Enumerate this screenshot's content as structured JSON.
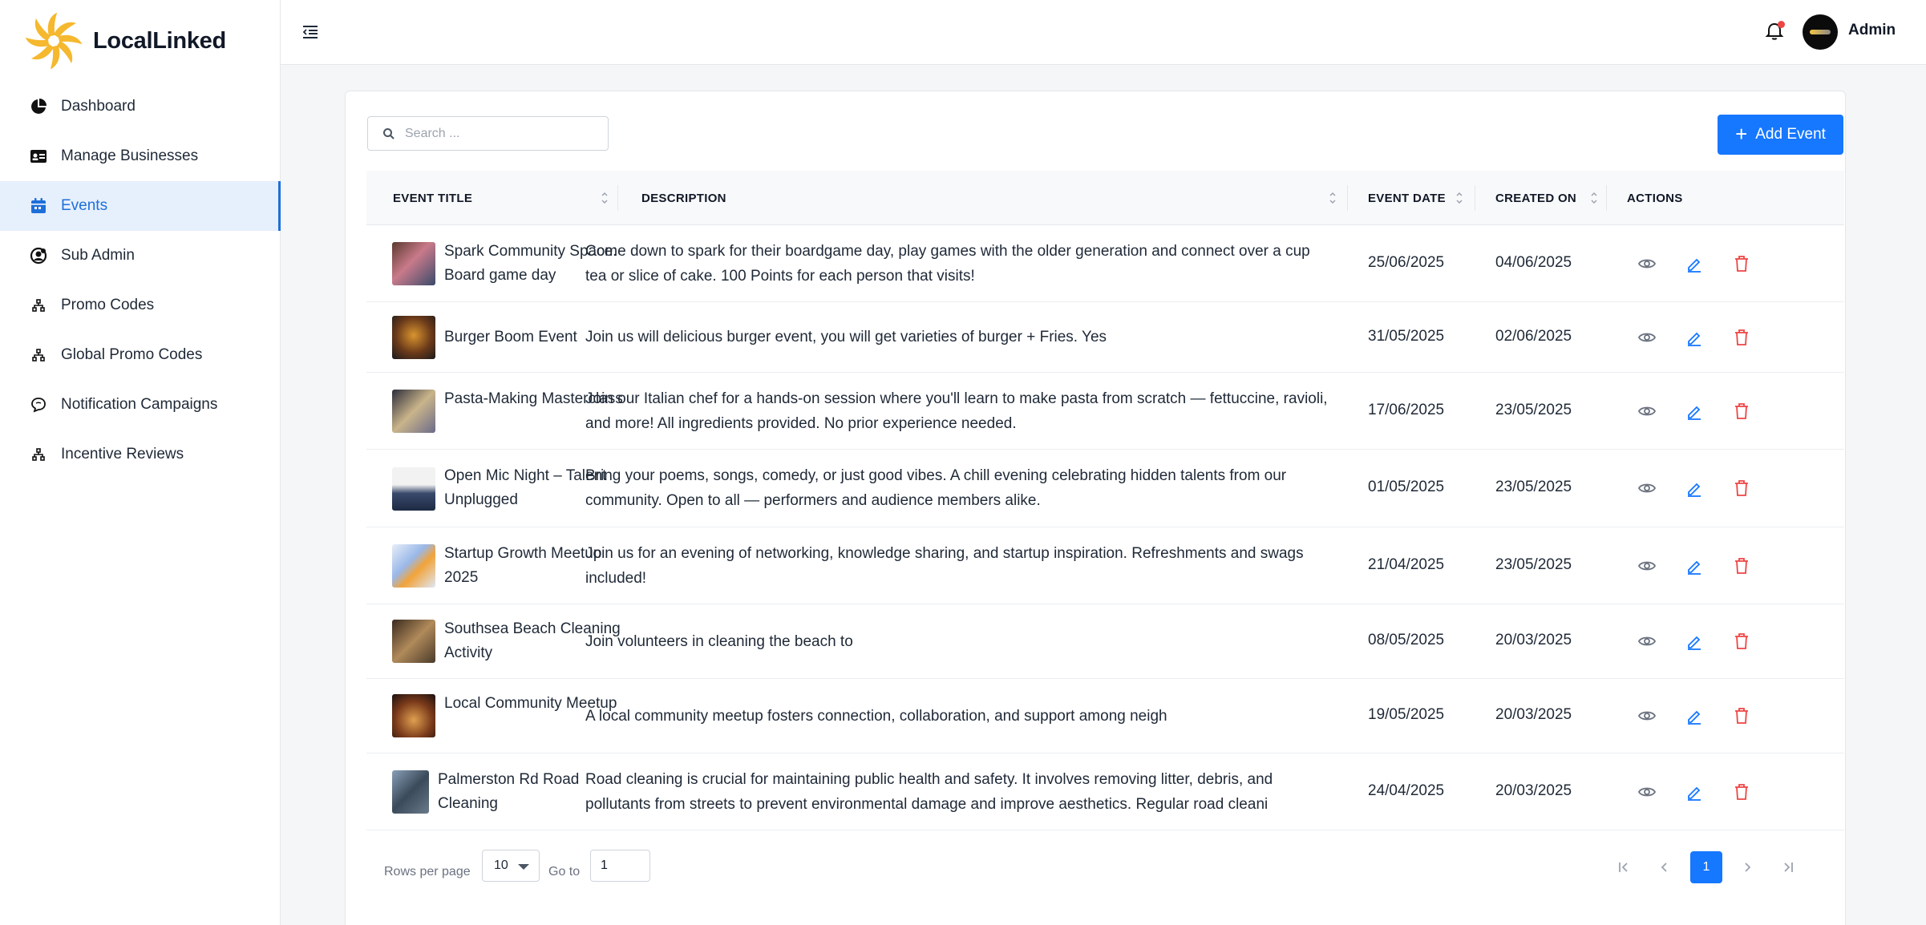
{
  "brand": {
    "name": "LocalLinked"
  },
  "sidebar": {
    "items": [
      {
        "label": "Dashboard",
        "icon": "pie-chart-icon",
        "active": false
      },
      {
        "label": "Manage Businesses",
        "icon": "id-card-icon",
        "active": false
      },
      {
        "label": "Events",
        "icon": "calendar-icon",
        "active": true
      },
      {
        "label": "Sub Admin",
        "icon": "user-circle-icon",
        "active": false
      },
      {
        "label": "Promo Codes",
        "icon": "hierarchy-icon",
        "active": false
      },
      {
        "label": "Global Promo Codes",
        "icon": "hierarchy-icon",
        "active": false
      },
      {
        "label": "Notification Campaigns",
        "icon": "chat-bubble-icon",
        "active": false
      },
      {
        "label": "Incentive Reviews",
        "icon": "hierarchy-icon",
        "active": false
      }
    ]
  },
  "header": {
    "user_name": "Admin",
    "has_notification": true
  },
  "toolbar": {
    "search_placeholder": "Search ...",
    "add_label": "Add Event"
  },
  "table": {
    "columns": [
      "EVENT TITLE",
      "DESCRIPTION",
      "EVENT DATE",
      "CREATED ON",
      "ACTIONS"
    ],
    "rows": [
      {
        "title": "Spark Community Space: Board game day",
        "description": "Come down to spark for their boardgame day, play games with the older generation and connect over a cup tea or slice of cake. 100 Points for each person that visits!",
        "event_date": "25/06/2025",
        "created_on": "04/06/2025"
      },
      {
        "title": "Burger Boom Event",
        "description": "Join us will delicious burger event, you will get varieties of burger + Fries. Yes",
        "event_date": "31/05/2025",
        "created_on": "02/06/2025"
      },
      {
        "title": "Pasta-Making Masterclass",
        "description": "Join our Italian chef for a hands-on session where you'll learn to make pasta from scratch — fettuccine, ravioli, and more! All ingredients provided. No prior experience needed.",
        "event_date": "17/06/2025",
        "created_on": "23/05/2025"
      },
      {
        "title": "Open Mic Night – Talent Unplugged",
        "description": "Bring your poems, songs, comedy, or just good vibes. A chill evening celebrating hidden talents from our community. Open to all — performers and audience members alike.",
        "event_date": "01/05/2025",
        "created_on": "23/05/2025"
      },
      {
        "title": "Startup Growth Meetup 2025",
        "description": "Join us for an evening of networking, knowledge sharing, and startup inspiration. Refreshments and swags included!",
        "event_date": "21/04/2025",
        "created_on": "23/05/2025"
      },
      {
        "title": "Southsea Beach Cleaning Activity",
        "description": "Join volunteers in cleaning the beach to",
        "event_date": "08/05/2025",
        "created_on": "20/03/2025"
      },
      {
        "title": "Local Community Meetup",
        "description": "A local community meetup fosters connection, collaboration, and support among neigh",
        "event_date": "19/05/2025",
        "created_on": "20/03/2025"
      },
      {
        "title": "Palmerston Rd Road Cleaning",
        "description": "Road cleaning is crucial for maintaining public health and safety. It involves removing litter, debris, and pollutants from streets to prevent environmental damage and improve aesthetics. Regular road cleani",
        "event_date": "24/04/2025",
        "created_on": "20/03/2025"
      }
    ]
  },
  "pagination": {
    "rows_per_page_label": "Rows per page",
    "rows_per_page": "10",
    "goto_label": "Go to",
    "goto_value": "1",
    "current_page": "1"
  },
  "colors": {
    "accent": "#1677ff",
    "active_nav_bg": "#e6f0fc",
    "delete": "#ef4444",
    "brand_logo": "#f5b82e"
  }
}
